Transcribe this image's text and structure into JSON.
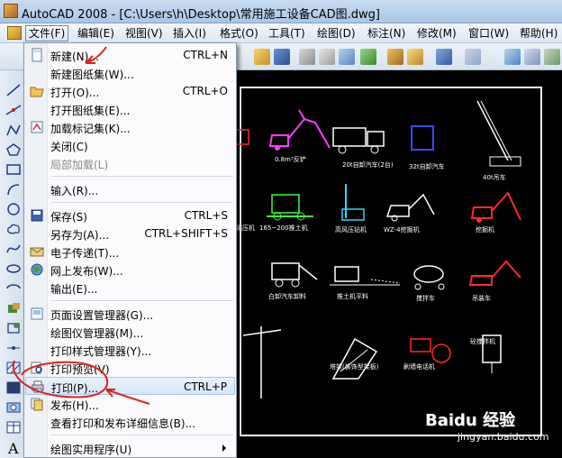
{
  "window": {
    "title": "AutoCAD 2008 - [C:\\Users\\h\\Desktop\\常用施工设备CAD图.dwg]"
  },
  "menubar": {
    "items": [
      {
        "label": "文件(F)",
        "active": true
      },
      {
        "label": "编辑(E)"
      },
      {
        "label": "视图(V)"
      },
      {
        "label": "插入(I)"
      },
      {
        "label": "格式(O)"
      },
      {
        "label": "工具(T)"
      },
      {
        "label": "绘图(D)"
      },
      {
        "label": "标注(N)"
      },
      {
        "label": "修改(M)"
      },
      {
        "label": "窗口(W)"
      },
      {
        "label": "帮助(H)"
      }
    ]
  },
  "file_menu": {
    "items": [
      {
        "label": "新建(N)...",
        "shortcut": "CTRL+N",
        "icon": "new-file-icon"
      },
      {
        "label": "新建图纸集(W)...",
        "shortcut": ""
      },
      {
        "label": "打开(O)...",
        "shortcut": "CTRL+O",
        "icon": "open-folder-icon"
      },
      {
        "label": "打开图纸集(E)...",
        "shortcut": ""
      },
      {
        "label": "加载标记集(K)...",
        "shortcut": "",
        "icon": "markup-icon"
      },
      {
        "label": "关闭(C)",
        "shortcut": ""
      },
      {
        "label": "局部加载(L)",
        "shortcut": "",
        "disabled": true
      },
      {
        "label": "输入(R)...",
        "shortcut": ""
      },
      {
        "label": "保存(S)",
        "shortcut": "CTRL+S",
        "icon": "save-icon"
      },
      {
        "label": "另存为(A)...",
        "shortcut": "CTRL+SHIFT+S"
      },
      {
        "label": "电子传递(T)...",
        "shortcut": "",
        "icon": "etransmit-icon"
      },
      {
        "label": "网上发布(W)...",
        "shortcut": "",
        "icon": "publish-web-icon"
      },
      {
        "label": "输出(E)...",
        "shortcut": ""
      },
      {
        "label": "页面设置管理器(G)...",
        "shortcut": "",
        "icon": "page-setup-icon"
      },
      {
        "label": "绘图仪管理器(M)...",
        "shortcut": ""
      },
      {
        "label": "打印样式管理器(Y)...",
        "shortcut": ""
      },
      {
        "label": "打印预览(V)",
        "shortcut": "",
        "icon": "print-preview-icon"
      },
      {
        "label": "打印(P)...",
        "shortcut": "CTRL+P",
        "icon": "print-icon"
      },
      {
        "label": "发布(H)...",
        "shortcut": "",
        "icon": "publish-icon"
      },
      {
        "label": "查看打印和发布详细信息(B)...",
        "shortcut": ""
      },
      {
        "label": "绘图实用程序(U)",
        "shortcut": "",
        "submenu": true
      }
    ]
  },
  "drawing": {
    "labels": [
      "0.8m³反铲",
      "20t自卸汽车(2台)",
      "32t自卸汽车",
      "40t吊车",
      "碾压机",
      "165~200推土机",
      "高风压钻机",
      "WZ-4挖掘机",
      "挖掘机",
      "白卸汽车卸料",
      "推土机平料",
      "搅拌车",
      "吊装车",
      "塔架(装饰型架板)",
      "刷墙电话机",
      "砼搅拌机"
    ]
  },
  "watermark": {
    "text": "Baidu 经验",
    "url": "jingyan.baidu.com"
  },
  "colors": {
    "titlebar": "#b7d0ec",
    "menu_bg": "#fbfbfd",
    "annotation": "#e0201c",
    "canvas": "#000000"
  }
}
